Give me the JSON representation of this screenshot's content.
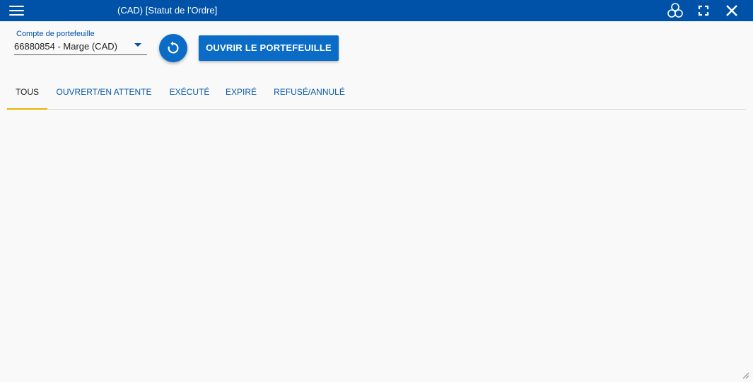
{
  "titlebar": {
    "title": "(CAD) [Statut de l'Ordre]",
    "icons": [
      "menu-icon",
      "link-icon",
      "expand-icon",
      "close-icon"
    ]
  },
  "account": {
    "label": "Compte de portefeuille",
    "value": "66880854 - Marge (CAD)"
  },
  "actions": {
    "open_label": "OUVRIR LE PORTEFEUILLE",
    "refresh_icon": "refresh-icon"
  },
  "tabs": [
    {
      "label": "TOUS",
      "active": true
    },
    {
      "label": "OUVRERT/EN ATTENTE",
      "active": false
    },
    {
      "label": "EXÉCUTÉ",
      "active": false
    },
    {
      "label": "EXPIRÉ",
      "active": false
    },
    {
      "label": "REFUSÉ/ANNULÉ",
      "active": false
    }
  ],
  "colors": {
    "titlebar": "#0052a8",
    "primary": "#0a6cc7",
    "tab_indicator": "#e8b400",
    "background": "#f9f9f9"
  }
}
